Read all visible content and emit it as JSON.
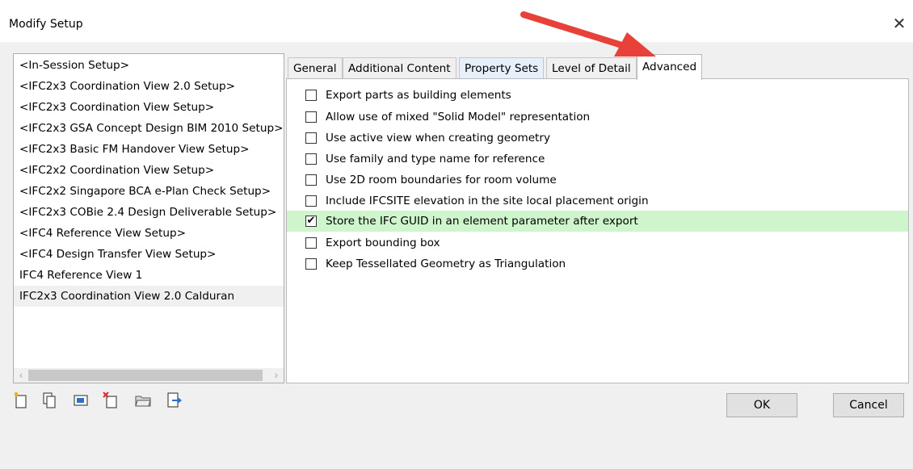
{
  "window": {
    "title": "Modify Setup"
  },
  "setups": [
    {
      "label": "<In-Session Setup>"
    },
    {
      "label": "<IFC2x3 Coordination View 2.0 Setup>"
    },
    {
      "label": "<IFC2x3 Coordination View Setup>"
    },
    {
      "label": "<IFC2x3 GSA Concept Design BIM 2010 Setup>"
    },
    {
      "label": "<IFC2x3 Basic FM Handover View Setup>"
    },
    {
      "label": "<IFC2x2 Coordination View Setup>"
    },
    {
      "label": "<IFC2x2 Singapore BCA e-Plan Check Setup>"
    },
    {
      "label": "<IFC2x3 COBie 2.4 Design Deliverable Setup>"
    },
    {
      "label": "<IFC4 Reference View Setup>"
    },
    {
      "label": "<IFC4 Design Transfer View Setup>"
    },
    {
      "label": "IFC4 Reference View 1"
    },
    {
      "label": "IFC2x3 Coordination View 2.0 Calduran",
      "selected": true
    }
  ],
  "tabs": [
    {
      "label": "General"
    },
    {
      "label": "Additional Content"
    },
    {
      "label": "Property Sets"
    },
    {
      "label": "Level of Detail"
    },
    {
      "label": "Advanced",
      "active": true
    }
  ],
  "options": [
    {
      "label": "Export parts as building elements",
      "checked": false
    },
    {
      "label": "Allow use of mixed \"Solid Model\" representation",
      "checked": false
    },
    {
      "label": "Use active view when creating geometry",
      "checked": false
    },
    {
      "label": "Use family and type name for reference",
      "checked": false
    },
    {
      "label": "Use 2D room boundaries for room volume",
      "checked": false
    },
    {
      "label": "Include IFCSITE elevation in the site local placement origin",
      "checked": false
    },
    {
      "label": "Store the IFC GUID in an element parameter after export",
      "checked": true,
      "highlighted": true
    },
    {
      "label": "Export bounding box",
      "checked": false
    },
    {
      "label": "Keep Tessellated Geometry as Triangulation",
      "checked": false
    }
  ],
  "toolbar_icons": [
    "new-setup-icon",
    "duplicate-setup-icon",
    "rename-setup-icon",
    "delete-setup-icon",
    "import-setup-icon",
    "export-setup-icon"
  ],
  "buttons": {
    "ok": "OK",
    "cancel": "Cancel"
  },
  "colors": {
    "highlight": "#cef5cc",
    "arrow": "#e8413a",
    "tab_tint": "#e6f0fa"
  },
  "check_mark": "✔",
  "scroll": {
    "left": "‹",
    "right": "›"
  },
  "close_glyph": "✕"
}
